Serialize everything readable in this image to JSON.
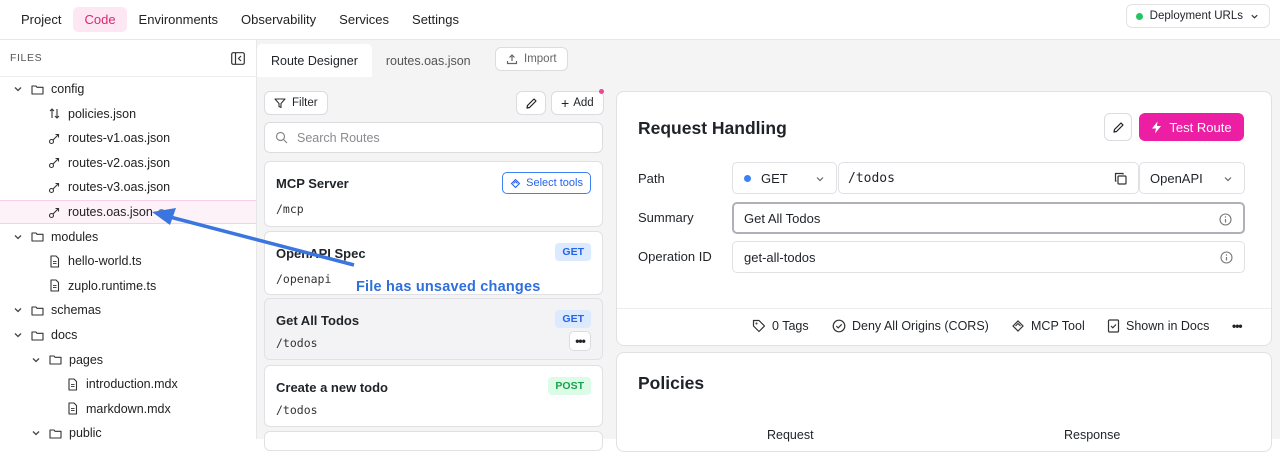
{
  "topnav": {
    "items": [
      {
        "label": "Project",
        "active": false
      },
      {
        "label": "Code",
        "active": true
      },
      {
        "label": "Environments",
        "active": false
      },
      {
        "label": "Observability",
        "active": false
      },
      {
        "label": "Services",
        "active": false
      },
      {
        "label": "Settings",
        "active": false
      }
    ],
    "deploy_label": "Deployment URLs"
  },
  "sidebar": {
    "title": "FILES",
    "tree": [
      {
        "label": "config",
        "type": "folder",
        "expanded": true,
        "depth": 0
      },
      {
        "label": "policies.json",
        "type": "file-policy",
        "depth": 1
      },
      {
        "label": "routes-v1.oas.json",
        "type": "file-route",
        "depth": 1
      },
      {
        "label": "routes-v2.oas.json",
        "type": "file-route",
        "depth": 1
      },
      {
        "label": "routes-v3.oas.json",
        "type": "file-route",
        "depth": 1
      },
      {
        "label": "routes.oas.json",
        "type": "file-route",
        "depth": 1,
        "selected": true,
        "unsaved": true
      },
      {
        "label": "modules",
        "type": "folder",
        "expanded": true,
        "depth": 0
      },
      {
        "label": "hello-world.ts",
        "type": "file",
        "depth": 1
      },
      {
        "label": "zuplo.runtime.ts",
        "type": "file",
        "depth": 1
      },
      {
        "label": "schemas",
        "type": "folder",
        "expanded": true,
        "depth": 0
      },
      {
        "label": "docs",
        "type": "folder",
        "expanded": true,
        "depth": 0
      },
      {
        "label": "pages",
        "type": "folder",
        "expanded": true,
        "depth": 1
      },
      {
        "label": "introduction.mdx",
        "type": "file",
        "depth": 2
      },
      {
        "label": "markdown.mdx",
        "type": "file",
        "depth": 2
      },
      {
        "label": "public",
        "type": "folder",
        "expanded": true,
        "depth": 1
      }
    ]
  },
  "tabs": [
    {
      "label": "Route Designer",
      "active": true
    },
    {
      "label": "routes.oas.json",
      "active": false
    }
  ],
  "import_label": "Import",
  "routelist": {
    "filter_label": "Filter",
    "add_label": "Add",
    "search_placeholder": "Search Routes",
    "routes": [
      {
        "name": "MCP Server",
        "path": "/mcp",
        "badge": "Select tools",
        "badge_kind": "tools"
      },
      {
        "name": "OpenAPI Spec",
        "path": "/openapi",
        "badge": "GET",
        "badge_kind": "get"
      },
      {
        "name": "Get All Todos",
        "path": "/todos",
        "badge": "GET",
        "badge_kind": "get",
        "selected": true,
        "more": "•••"
      },
      {
        "name": "Create a new todo",
        "path": "/todos",
        "badge": "POST",
        "badge_kind": "post"
      }
    ]
  },
  "request": {
    "title": "Request Handling",
    "test_label": "Test Route",
    "path_label": "Path",
    "method": "GET",
    "path_value": "/todos",
    "spec_select": "OpenAPI",
    "summary_label": "Summary",
    "summary_value": "Get All Todos",
    "opid_label": "Operation ID",
    "opid_value": "get-all-todos",
    "footer": {
      "tags": "0 Tags",
      "cors": "Deny All Origins (CORS)",
      "mcp": "MCP Tool",
      "docs": "Shown in Docs",
      "more": "•••"
    }
  },
  "policies": {
    "title": "Policies",
    "col_request": "Request",
    "col_response": "Response"
  },
  "annotation": {
    "text": "File has unsaved changes",
    "color": "#2f6fdc"
  },
  "colors": {
    "accent": "#ec1ea4",
    "nav_active_bg": "#fce7f3",
    "get_badge": "#2563eb",
    "post_badge": "#16a34a",
    "status_green": "#22c55e"
  }
}
